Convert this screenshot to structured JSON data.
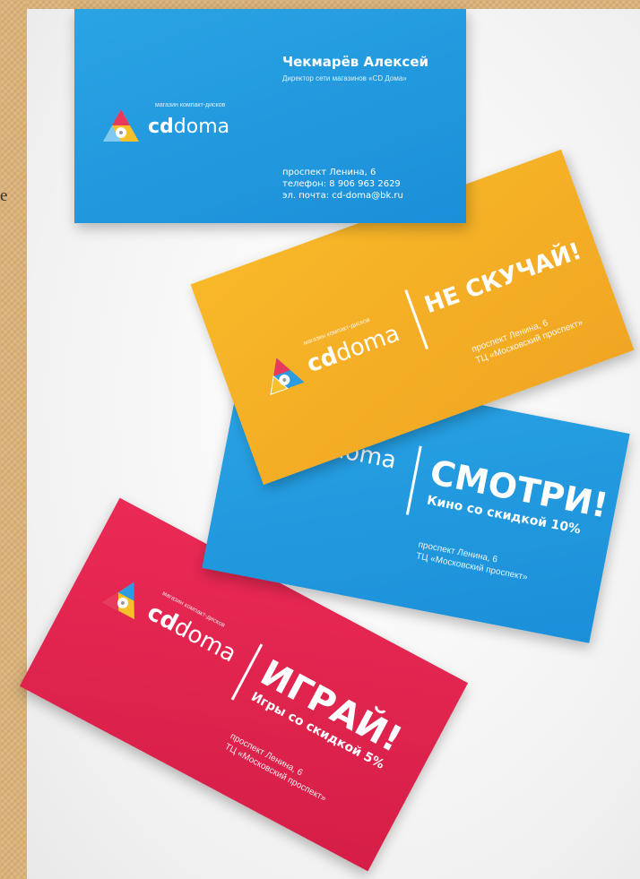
{
  "stray_letter": "e",
  "logo": {
    "tagline": "магазин компакт-дисков",
    "brand_bold": "cd",
    "brand_light": "doma"
  },
  "card_main": {
    "name": "Чекмарёв Алексей",
    "position": "Директор сети магазинов «CD Дома»",
    "address": "проспект Ленина, 6",
    "phone": "телефон:  8 906 963 2629",
    "email": "эл. почта: cd-doma@bk.ru"
  },
  "card_yellow": {
    "headline": "НЕ СКУЧАЙ!",
    "address_line1": "проспект Ленина, 6",
    "address_line2": "ТЦ «Московский проспект»"
  },
  "card_blue": {
    "headline": "СМОТРИ!",
    "subline": "Кино со скидкой 10%",
    "address_line1": "проспект Ленина, 6",
    "address_line2": "ТЦ «Московский проспект»"
  },
  "card_red": {
    "headline": "ИГРАЙ!",
    "subline": "Игры со скидкой 5%",
    "address_line1": "проспект Ленина, 6",
    "address_line2": "ТЦ «Московский проспект»"
  },
  "colors": {
    "blue": "#1b8fd9",
    "yellow": "#f1a623",
    "red": "#d51e47",
    "frame": "#d9b27a"
  }
}
